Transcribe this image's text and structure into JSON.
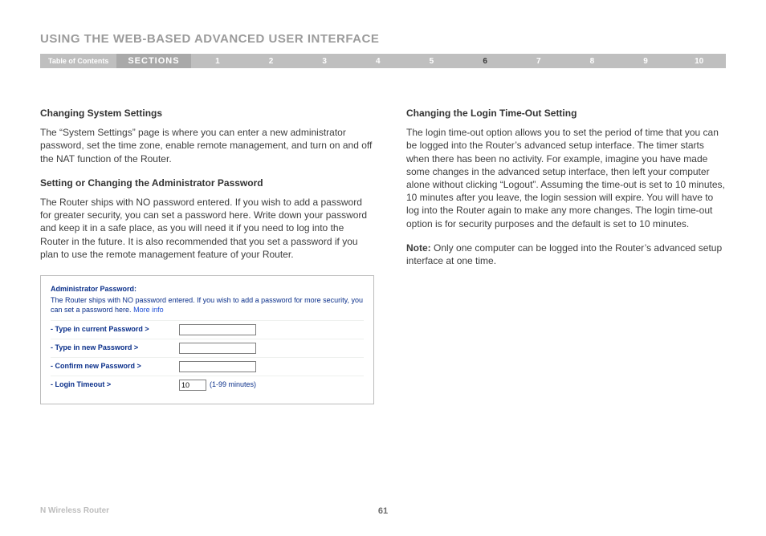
{
  "header": {
    "title": "USING THE WEB-BASED ADVANCED USER INTERFACE"
  },
  "nav": {
    "toc": "Table of Contents",
    "sections_label": "SECTIONS",
    "items": [
      "1",
      "2",
      "3",
      "4",
      "5",
      "6",
      "7",
      "8",
      "9",
      "10"
    ],
    "active": "6"
  },
  "left": {
    "h1": "Changing System Settings",
    "p1": "The “System Settings” page is where you can enter a new administrator password, set the time zone, enable remote management, and turn on and off the NAT function of the Router.",
    "h2": "Setting or Changing the Administrator Password",
    "p2": "The Router ships with NO password entered. If you wish to add a password for greater security, you can set a password here. Write down your password and keep it in a safe place, as you will need it if you need to log into the Router in the future. It is also recommended that you set a password if you plan to use the remote management feature of your Router."
  },
  "router_box": {
    "title": "Administrator Password:",
    "desc": "The Router ships with NO password entered. If you wish to add a password for more security, you can set a password here.",
    "more_info": "More info",
    "rows": {
      "current": "- Type in current Password >",
      "newpw": "- Type in new Password >",
      "confirm": "- Confirm new Password >",
      "timeout": "- Login Timeout >"
    },
    "timeout_value": "10",
    "timeout_hint": "(1-99 minutes)"
  },
  "right": {
    "h1": "Changing the Login Time-Out Setting",
    "p1": "The login time-out option allows you to set the period of time that you can be logged into the Router’s advanced setup interface. The timer starts when there has been no activity. For example, imagine you have made some changes in the advanced setup interface, then left your computer alone without clicking “Logout”. Assuming the time-out is set to 10 minutes, 10 minutes after you leave, the login session will expire. You will have to log into the Router again to make any more changes. The login time-out option is for security purposes and the default is set to 10 minutes.",
    "note_label": "Note:",
    "note_text": " Only one computer can be logged into the Router’s advanced setup interface at one time."
  },
  "footer": {
    "product": "N Wireless Router",
    "page": "61"
  }
}
